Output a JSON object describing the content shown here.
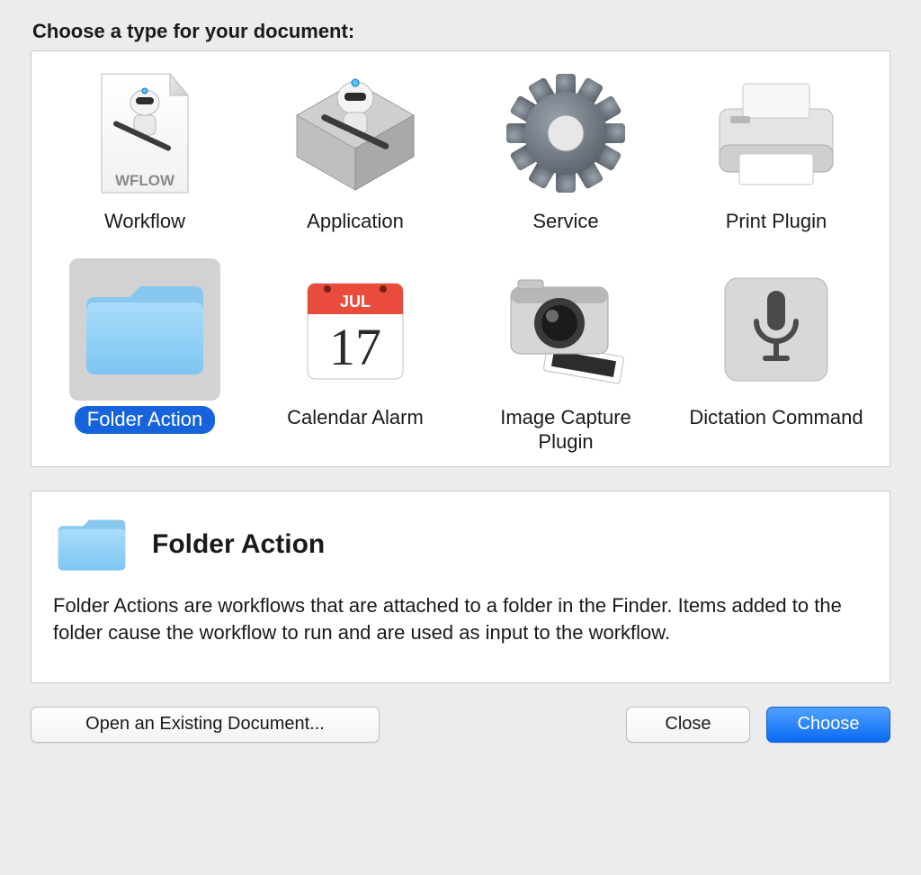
{
  "heading": "Choose a type for your document:",
  "types": [
    {
      "id": "workflow",
      "label": "Workflow",
      "selected": false
    },
    {
      "id": "application",
      "label": "Application",
      "selected": false
    },
    {
      "id": "service",
      "label": "Service",
      "selected": false
    },
    {
      "id": "print-plugin",
      "label": "Print Plugin",
      "selected": false
    },
    {
      "id": "folder-action",
      "label": "Folder Action",
      "selected": true
    },
    {
      "id": "calendar-alarm",
      "label": "Calendar Alarm",
      "selected": false
    },
    {
      "id": "image-capture",
      "label": "Image Capture Plugin",
      "selected": false
    },
    {
      "id": "dictation",
      "label": "Dictation Command",
      "selected": false
    }
  ],
  "calendar": {
    "month": "JUL",
    "day": "17"
  },
  "wflow_label": "WFLOW",
  "description": {
    "title": "Folder Action",
    "body": "Folder Actions are workflows that are attached to a folder in the Finder. Items added to the folder cause the workflow to run and are used as input to the workflow."
  },
  "buttons": {
    "open": "Open an Existing Document...",
    "close": "Close",
    "choose": "Choose"
  }
}
